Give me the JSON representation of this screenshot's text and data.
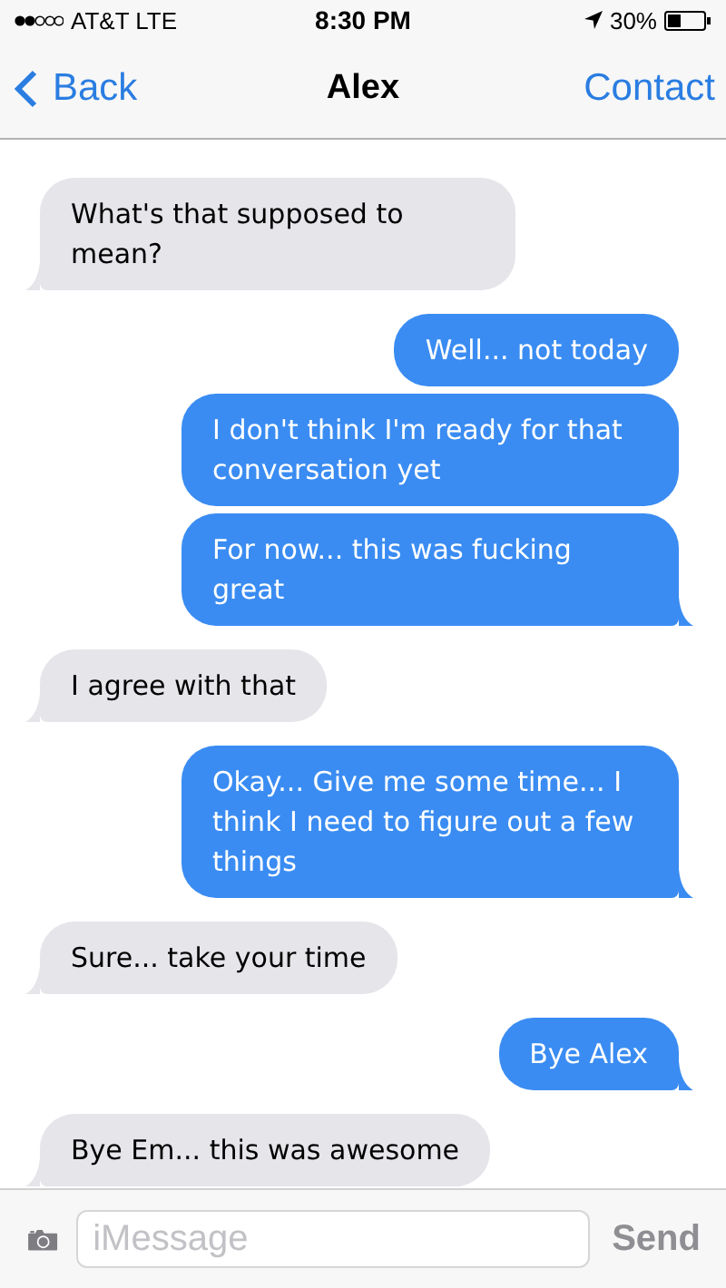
{
  "status_bar": {
    "carrier": "AT&T LTE",
    "time": "8:30 PM",
    "battery": "30%"
  },
  "nav": {
    "back": "Back",
    "title": "Alex",
    "action": "Contact"
  },
  "messages": [
    {
      "kind": "received",
      "text": "What's that supposed to mean?"
    },
    {
      "kind": "sent",
      "text": "Well... not today"
    },
    {
      "kind": "sent",
      "text": "I don't think I'm ready for that conversation yet"
    },
    {
      "kind": "sent",
      "text": "For now... this was fucking great"
    },
    {
      "kind": "received",
      "text": "I agree with that"
    },
    {
      "kind": "sent",
      "text": "Okay... Give me some time... I think I need to figure out a few things"
    },
    {
      "kind": "received",
      "text": "Sure... take your time"
    },
    {
      "kind": "sent",
      "text": "Bye Alex"
    },
    {
      "kind": "received",
      "text": "Bye Em... this was awesome"
    }
  ],
  "composer": {
    "placeholder": "iMessage",
    "send": "Send"
  }
}
